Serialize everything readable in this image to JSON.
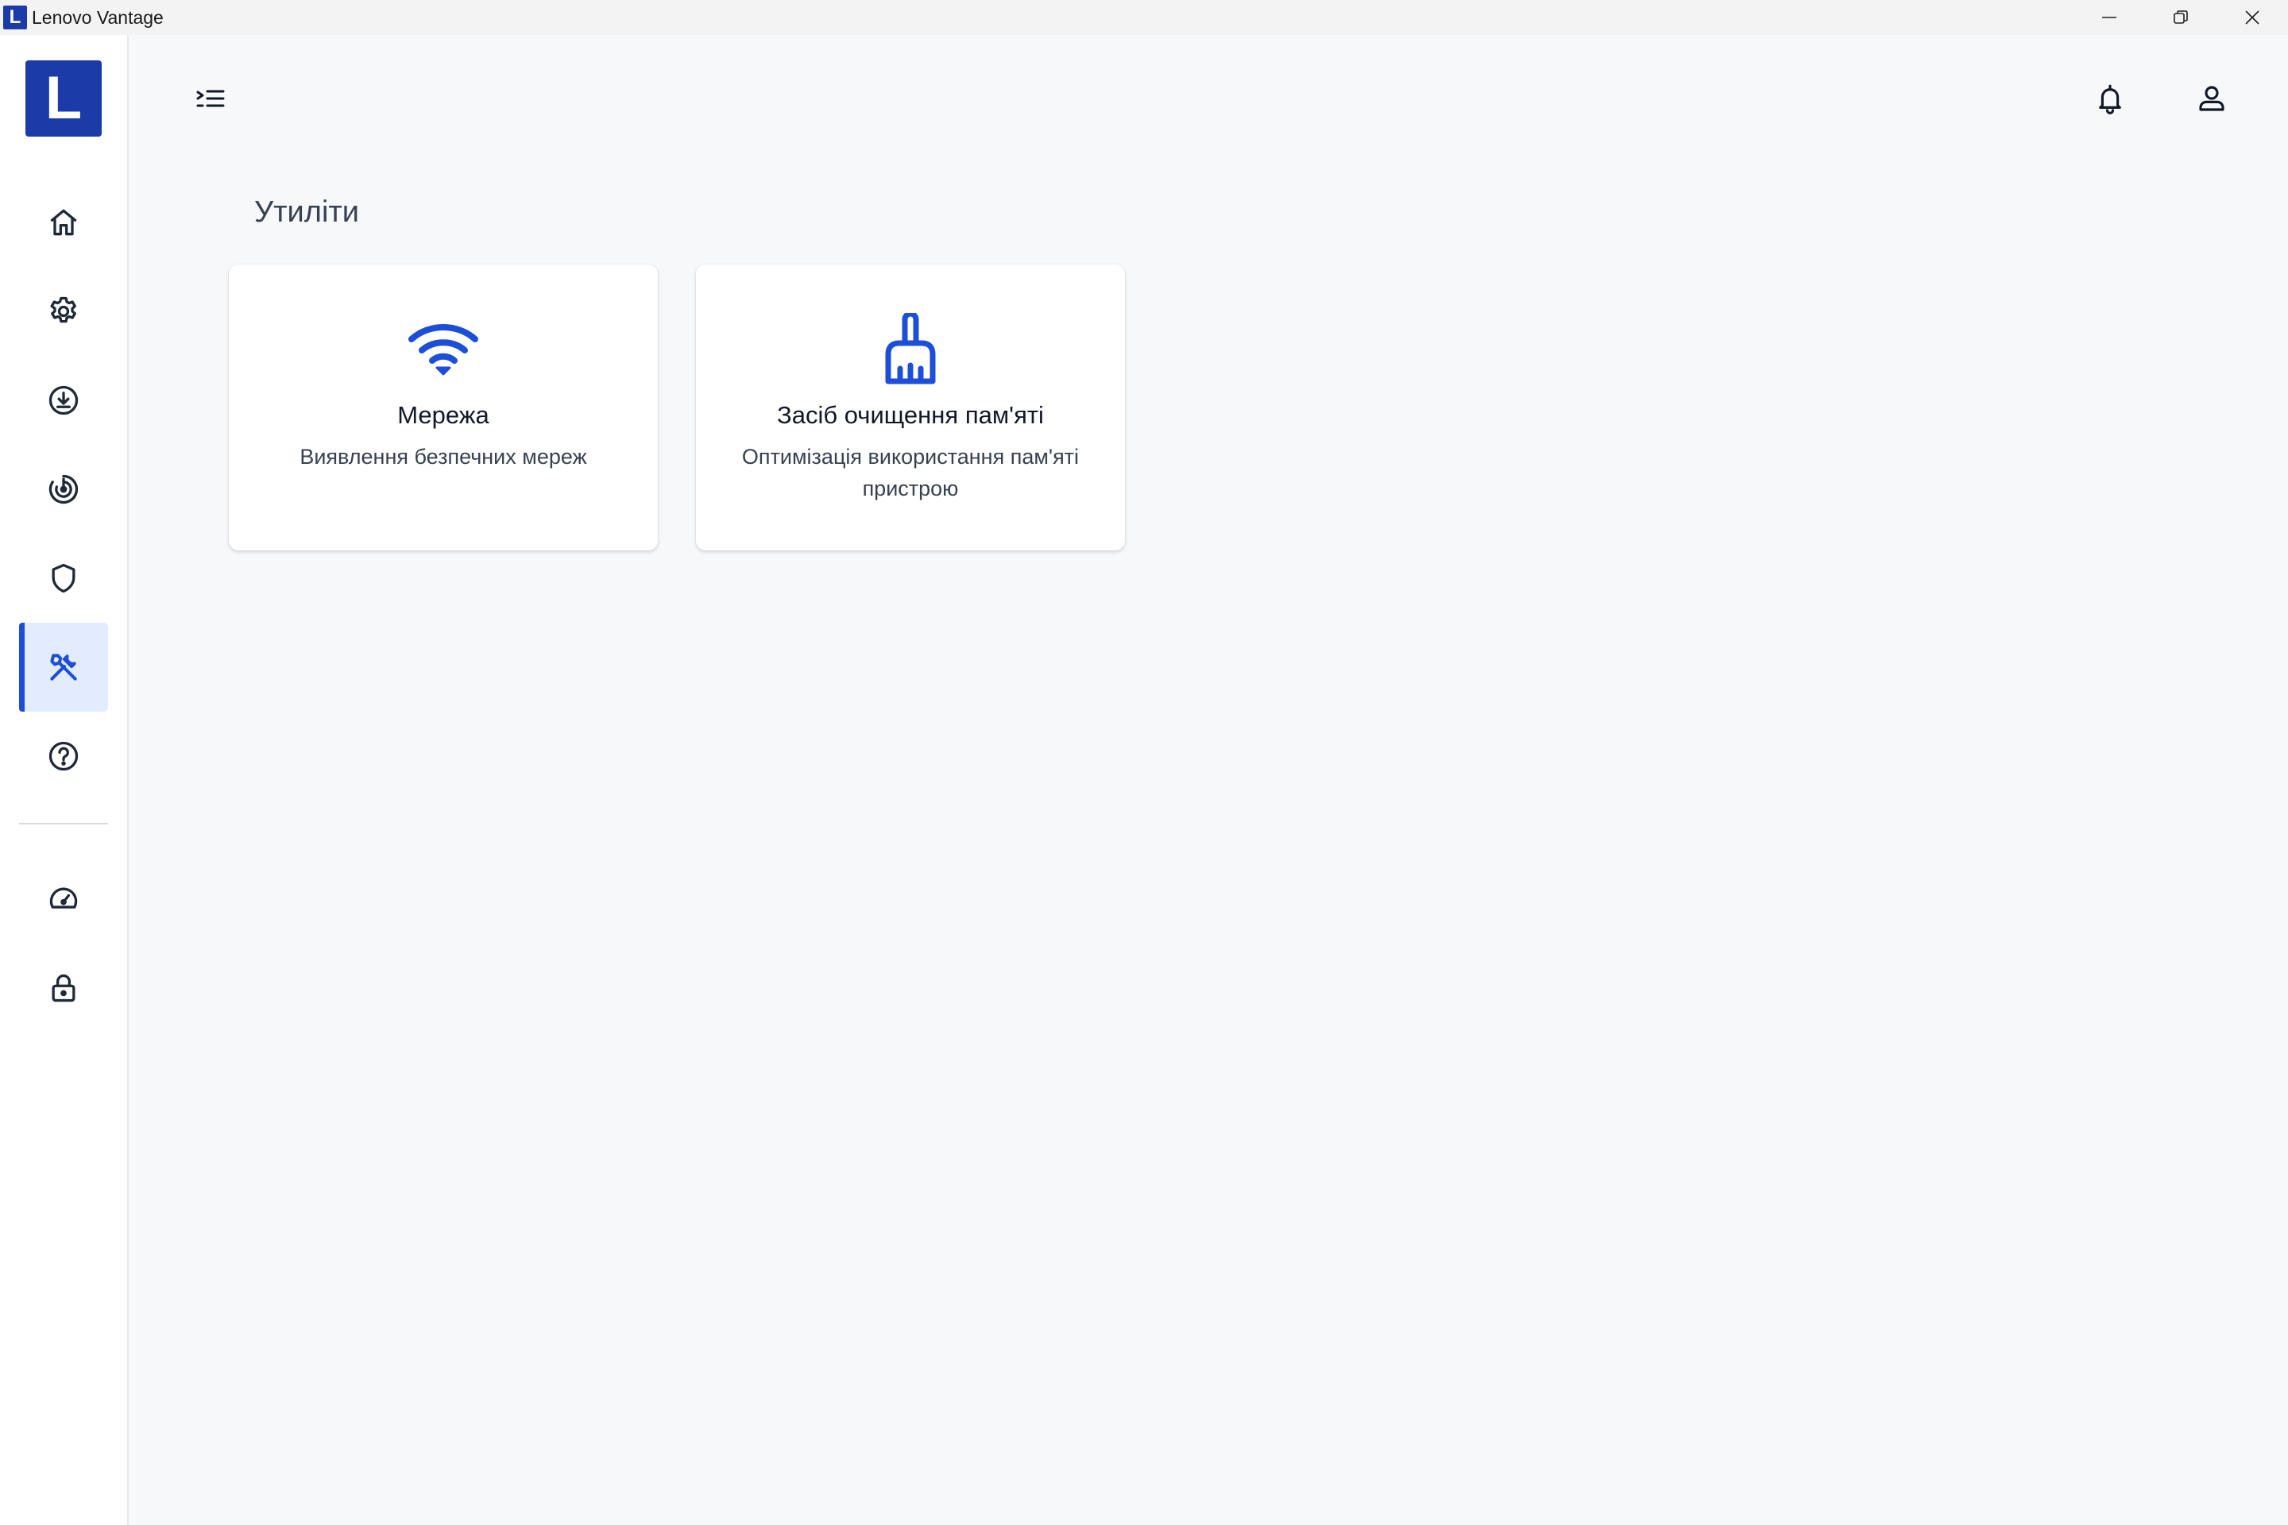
{
  "window": {
    "logo_letter": "L",
    "title": "Lenovo Vantage"
  },
  "sidebar": {
    "logo_letter": "L",
    "items": [
      {
        "id": "home",
        "icon": "home-icon"
      },
      {
        "id": "settings",
        "icon": "gear-icon"
      },
      {
        "id": "updates",
        "icon": "download-icon"
      },
      {
        "id": "smart-performance",
        "icon": "radar-icon"
      },
      {
        "id": "security",
        "icon": "shield-icon"
      },
      {
        "id": "utilities",
        "icon": "tools-icon",
        "active": true
      },
      {
        "id": "help",
        "icon": "help-icon"
      },
      {
        "id": "performance",
        "icon": "speedometer-icon"
      },
      {
        "id": "lock",
        "icon": "lock-icon"
      }
    ]
  },
  "header": {
    "menu_icon": "menu-collapse-icon",
    "notifications_icon": "bell-icon",
    "account_icon": "user-icon"
  },
  "main": {
    "title": "Утиліти",
    "cards": [
      {
        "icon": "wifi-icon",
        "title": "Мережа",
        "description": "Виявлення безпечних мереж"
      },
      {
        "icon": "broom-icon",
        "title": "Засіб очищення пам'яті",
        "description": "Оптимізація використання пам'яті пристрою"
      }
    ]
  },
  "colors": {
    "accent": "#1c4ed8",
    "brand": "#1a3ba8",
    "active_bg": "#e3ecff",
    "background": "#f7f8fa"
  }
}
